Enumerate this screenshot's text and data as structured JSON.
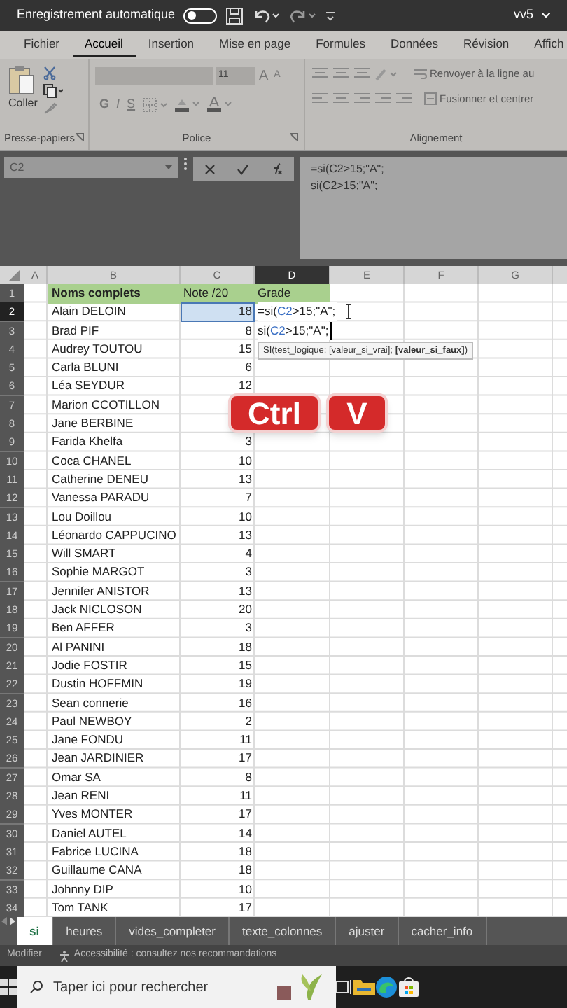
{
  "title_bar": {
    "autosave_label": "Enregistrement automatique",
    "autosave_on": false,
    "file_name": "vv5"
  },
  "ribbon_tabs": [
    {
      "label": "Fichier",
      "selected": false
    },
    {
      "label": "Accueil",
      "selected": true
    },
    {
      "label": "Insertion",
      "selected": false
    },
    {
      "label": "Mise en page",
      "selected": false
    },
    {
      "label": "Formules",
      "selected": false
    },
    {
      "label": "Données",
      "selected": false
    },
    {
      "label": "Révision",
      "selected": false
    },
    {
      "label": "Affich",
      "selected": false
    }
  ],
  "clipboard": {
    "paste_label": "Coller",
    "group_label": "Presse-papiers"
  },
  "font": {
    "size": "11",
    "grow": "A",
    "shrink": "A",
    "bold": "G",
    "italic": "I",
    "underline": "S",
    "group_label": "Police"
  },
  "alignment": {
    "wrap": "Renvoyer à la ligne au",
    "merge": "Fusionner et centrer",
    "group_label": "Alignement"
  },
  "formula_bar": {
    "name_box": "C2",
    "lines": [
      "=si(C2>15;\"A\";",
      "si(C2>15;\"A\";"
    ]
  },
  "columns": [
    {
      "label": "A",
      "selected": false
    },
    {
      "label": "B",
      "selected": false
    },
    {
      "label": "C",
      "selected": false
    },
    {
      "label": "D",
      "selected": true
    },
    {
      "label": "E",
      "selected": false
    },
    {
      "label": "F",
      "selected": false
    },
    {
      "label": "G",
      "selected": false
    }
  ],
  "rows": [
    {
      "num": "1",
      "kind": "header",
      "selected": false,
      "name": "Noms complets",
      "note": "Note /20",
      "grade": "Grade"
    },
    {
      "num": "2",
      "kind": "data",
      "selected": true,
      "name": "Alain DELOIN",
      "note": "18",
      "formula": {
        "prefix": "=si(",
        "ref": "C2",
        "suffix": ">15;\"A\";"
      }
    },
    {
      "num": "3",
      "kind": "data",
      "selected": false,
      "name": "Brad PIF",
      "note": "8",
      "formula": {
        "prefix": "si(",
        "ref": "C2",
        "suffix": ">15;\"A\";"
      }
    },
    {
      "num": "4",
      "kind": "data",
      "selected": false,
      "name": "Audrey TOUTOU",
      "note": "15"
    },
    {
      "num": "5",
      "kind": "data",
      "selected": false,
      "name": "Carla BLUNI",
      "note": "6"
    },
    {
      "num": "6",
      "kind": "data",
      "selected": false,
      "name": "Léa SEYDUR",
      "note": "12"
    },
    {
      "num": "7",
      "kind": "data",
      "selected": false,
      "name": "Marion CCOTILLON"
    },
    {
      "num": "8",
      "kind": "data",
      "selected": false,
      "name": "Jane BERBINE"
    },
    {
      "num": "9",
      "kind": "data",
      "selected": false,
      "name": "Farida Khelfa",
      "note": "3"
    },
    {
      "num": "10",
      "kind": "data",
      "selected": false,
      "name": "Coca CHANEL",
      "note": "10"
    },
    {
      "num": "11",
      "kind": "data",
      "selected": false,
      "name": "Catherine DENEU",
      "note": "13"
    },
    {
      "num": "12",
      "kind": "data",
      "selected": false,
      "name": "Vanessa PARADU",
      "note": "7"
    },
    {
      "num": "13",
      "kind": "data",
      "selected": false,
      "name": "Lou Doillou",
      "note": "10"
    },
    {
      "num": "14",
      "kind": "data",
      "selected": false,
      "name": "Léonardo CAPPUCINO",
      "note": "13"
    },
    {
      "num": "15",
      "kind": "data",
      "selected": false,
      "name": "Will SMART",
      "note": "4"
    },
    {
      "num": "16",
      "kind": "data",
      "selected": false,
      "name": "Sophie MARGOT",
      "note": "3"
    },
    {
      "num": "17",
      "kind": "data",
      "selected": false,
      "name": "Jennifer ANISTOR",
      "note": "13"
    },
    {
      "num": "18",
      "kind": "data",
      "selected": false,
      "name": "Jack NICLOSON",
      "note": "20"
    },
    {
      "num": "19",
      "kind": "data",
      "selected": false,
      "name": "Ben AFFER",
      "note": "3"
    },
    {
      "num": "20",
      "kind": "data",
      "selected": false,
      "name": "Al PANINI",
      "note": "18"
    },
    {
      "num": "21",
      "kind": "data",
      "selected": false,
      "name": "Jodie FOSTIR",
      "note": "15"
    },
    {
      "num": "22",
      "kind": "data",
      "selected": false,
      "name": "Dustin HOFFMIN",
      "note": "19"
    },
    {
      "num": "23",
      "kind": "data",
      "selected": false,
      "name": "Sean connerie",
      "note": "16"
    },
    {
      "num": "24",
      "kind": "data",
      "selected": false,
      "name": "Paul NEWBOY",
      "note": "2"
    },
    {
      "num": "25",
      "kind": "data",
      "selected": false,
      "name": "Jane FONDU",
      "note": "11"
    },
    {
      "num": "26",
      "kind": "data",
      "selected": false,
      "name": "Jean JARDINIER",
      "note": "17"
    },
    {
      "num": "27",
      "kind": "data",
      "selected": false,
      "name": "Omar SA",
      "note": "8"
    },
    {
      "num": "28",
      "kind": "data",
      "selected": false,
      "name": "Jean RENI",
      "note": "11"
    },
    {
      "num": "29",
      "kind": "data",
      "selected": false,
      "name": "Yves MONTER",
      "note": "17"
    },
    {
      "num": "30",
      "kind": "data",
      "selected": false,
      "name": "Daniel AUTEL",
      "note": "14"
    },
    {
      "num": "31",
      "kind": "data",
      "selected": false,
      "name": "Fabrice LUCINA",
      "note": "18"
    },
    {
      "num": "32",
      "kind": "data",
      "selected": false,
      "name": "Guillaume CANA",
      "note": "18"
    },
    {
      "num": "33",
      "kind": "data",
      "selected": false,
      "name": "Johnny DIP",
      "note": "10"
    },
    {
      "num": "34",
      "kind": "data",
      "selected": false,
      "name": "Tom TANK",
      "note": "17"
    }
  ],
  "tooltip": "SI(test_logique; [valeur_si_vrai]; **[valeur_si_faux]**)",
  "keys": [
    "Ctrl",
    "V"
  ],
  "sheet_tabs": [
    {
      "label": "si",
      "selected": true
    },
    {
      "label": "heures",
      "selected": false
    },
    {
      "label": "vides_completer",
      "selected": false
    },
    {
      "label": "texte_colonnes",
      "selected": false
    },
    {
      "label": "ajuster",
      "selected": false
    },
    {
      "label": "cacher_info",
      "selected": false
    }
  ],
  "status_bar": {
    "mode": "Modifier",
    "accessibility": "Accessibilité : consultez nos recommandations"
  },
  "taskbar": {
    "search_placeholder": "Taper ici pour rechercher"
  }
}
